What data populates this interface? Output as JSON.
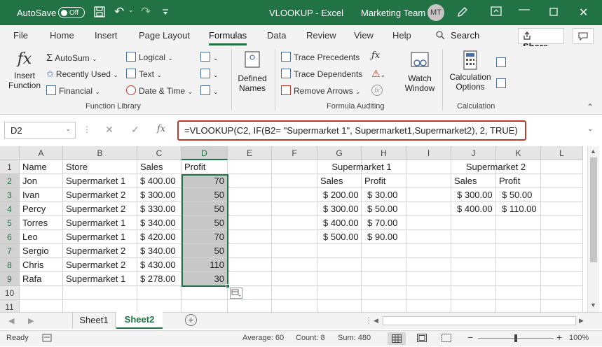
{
  "titlebar": {
    "autosave_label": "AutoSave",
    "toggle_state": "Off",
    "filename": "VLOOKUP",
    "app": "Excel",
    "team": "Marketing Team",
    "avatar_initials": "MT"
  },
  "tabs": [
    "File",
    "Home",
    "Insert",
    "Page Layout",
    "Formulas",
    "Data",
    "Review",
    "View",
    "Help"
  ],
  "active_tab": "Formulas",
  "search_label": "Search",
  "share_label": "Share",
  "ribbon": {
    "insert_function": [
      "Insert",
      "Function"
    ],
    "autosum": "AutoSum",
    "recently_used": "Recently Used",
    "financial": "Financial",
    "logical": "Logical",
    "text": "Text",
    "date_time": "Date & Time",
    "defined_names": [
      "Defined",
      "Names"
    ],
    "trace_precedents": "Trace Precedents",
    "trace_dependents": "Trace Dependents",
    "remove_arrows": "Remove Arrows",
    "watch_window": [
      "Watch",
      "Window"
    ],
    "calc_options": [
      "Calculation",
      "Options"
    ],
    "group_function_library": "Function Library",
    "group_formula_auditing": "Formula Auditing",
    "group_calculation": "Calculation"
  },
  "formula_bar": {
    "name_box": "D2",
    "formula": "=VLOOKUP(C2, IF(B2= \"Supermarket 1\", Supermarket1,Supermarket2), 2, TRUE)"
  },
  "columns": [
    "A",
    "B",
    "C",
    "D",
    "E",
    "F",
    "G",
    "H",
    "I",
    "J",
    "K",
    "L"
  ],
  "rows": [
    "1",
    "2",
    "3",
    "4",
    "5",
    "6",
    "7",
    "8",
    "9",
    "10",
    "11"
  ],
  "main_table": {
    "headers": [
      "Name",
      "Store",
      "Sales",
      "Profit"
    ],
    "rows": [
      [
        "Jon",
        "Supermarket 1",
        "$ 400.00",
        "70"
      ],
      [
        "Ivan",
        "Supermarket 2",
        "$ 300.00",
        "50"
      ],
      [
        "Percy",
        "Supermarket 2",
        "$ 330.00",
        "50"
      ],
      [
        "Torres",
        "Supermarket 1",
        "$ 340.00",
        "50"
      ],
      [
        "Leo",
        "Supermarket 1",
        "$ 420.00",
        "70"
      ],
      [
        "Sergio",
        "Supermarket 2",
        "$ 340.00",
        "50"
      ],
      [
        "Chris",
        "Supermarket 2",
        "$ 430.00",
        "110"
      ],
      [
        "Rafa",
        "Supermarket 1",
        "$ 278.00",
        "30"
      ]
    ]
  },
  "sm1": {
    "title": "Supermarket 1",
    "headers": [
      "Sales",
      "Profit"
    ],
    "rows": [
      [
        "$ 200.00",
        "$ 30.00"
      ],
      [
        "$ 300.00",
        "$ 50.00"
      ],
      [
        "$ 400.00",
        "$ 70.00"
      ],
      [
        "$ 500.00",
        "$ 90.00"
      ]
    ]
  },
  "sm2": {
    "title": "Supermarket 2",
    "headers": [
      "Sales",
      "Profit"
    ],
    "rows": [
      [
        "$ 300.00",
        "$ 50.00"
      ],
      [
        "$ 400.00",
        "$ 110.00"
      ]
    ]
  },
  "sheets": [
    "Sheet1",
    "Sheet2"
  ],
  "active_sheet": "Sheet2",
  "status": {
    "ready": "Ready",
    "average": "Average: 60",
    "count": "Count: 8",
    "sum": "Sum: 480",
    "zoom": "100%"
  },
  "colors": {
    "excel_green": "#217346",
    "highlight": "#c0392b",
    "selection": "#c8c8c8"
  }
}
